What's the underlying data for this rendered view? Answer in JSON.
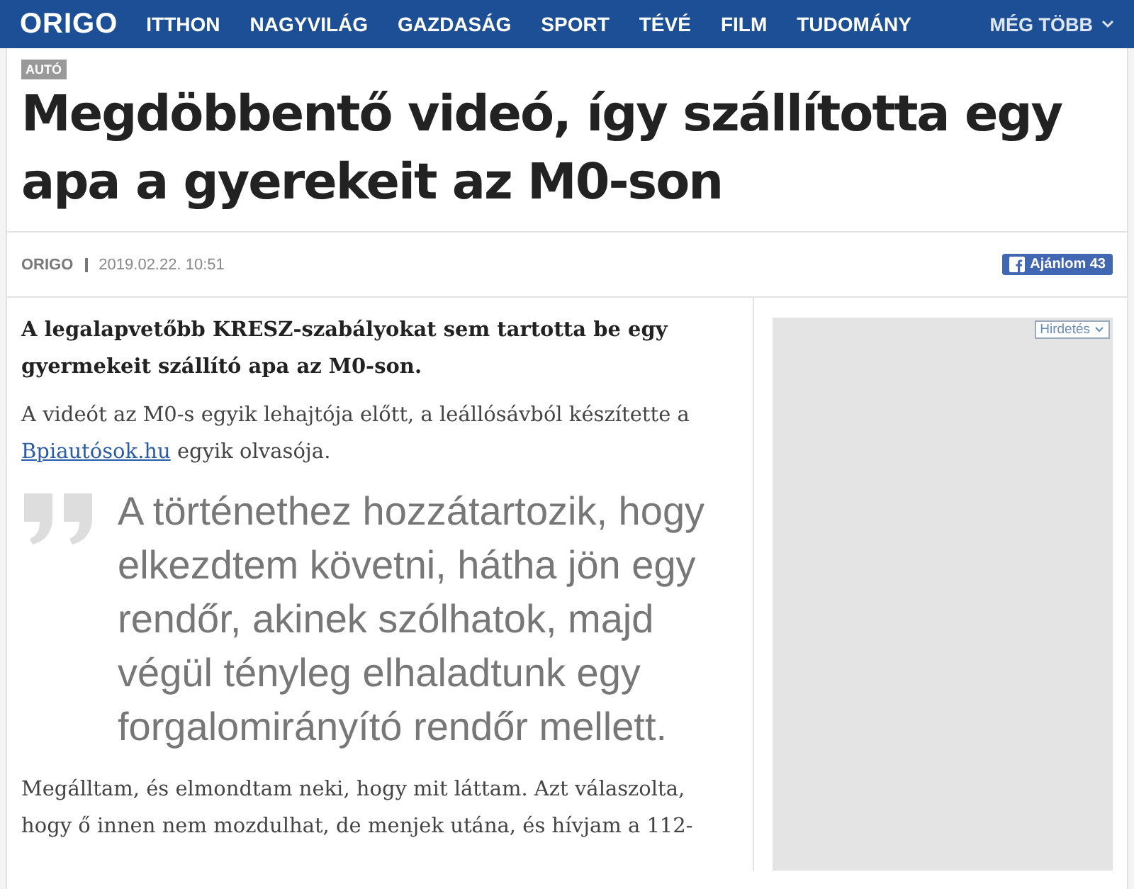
{
  "nav": {
    "logo": "ORIGO",
    "items": [
      "ITTHON",
      "NAGYVILÁG",
      "GAZDASÁG",
      "SPORT",
      "TÉVÉ",
      "FILM",
      "TUDOMÁNY"
    ],
    "more": "MÉG TÖBB"
  },
  "article": {
    "tag": "AUTÓ",
    "title": "Megdöbbentő videó, így szállította egy apa a gyerekeit az M0-son",
    "source": "ORIGO",
    "date": "2019.02.22. 10:51",
    "like_button": {
      "label": "Ajánlom",
      "count": "43"
    },
    "lead": "A legalapvetőbb KRESZ-szabályokat sem tartotta be egy gyermekeit szállító apa az M0-son.",
    "intro": {
      "before": "A videót az M0-s egyik lehajtója előtt, a leállósávból készítette a ",
      "link": "Bpiautósok.hu",
      "after": " egyik olvasója."
    },
    "quote": "A történethez hozzátartozik, hogy elkezdtem követni, hátha jön egy rendőr, akinek szólhatok, majd végül tényleg elhaladtunk egy forgalomirányító rendőr mellett.",
    "paragraph": "Megálltam, és elmondtam neki, hogy mit láttam. Azt válaszolta, hogy ő innen nem mozdulhat, de menjek utána, és hívjam a 112-"
  },
  "ad": {
    "label": "Hirdetés"
  }
}
